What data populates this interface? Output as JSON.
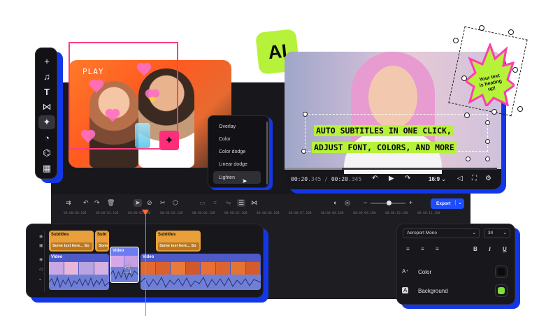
{
  "accent": "#1437e6",
  "lime": "#b6f23a",
  "toolbar": {
    "tools": [
      {
        "icon": "plus-icon",
        "glyph": "+"
      },
      {
        "icon": "music-add-icon",
        "glyph": "♫"
      },
      {
        "icon": "text-icon",
        "glyph": "T"
      },
      {
        "icon": "transition-icon",
        "glyph": "⋈"
      },
      {
        "icon": "effects-icon",
        "glyph": "✦"
      },
      {
        "icon": "filter-icon",
        "glyph": "◔"
      },
      {
        "icon": "sticker-icon",
        "glyph": "⌬"
      },
      {
        "icon": "templates-icon",
        "glyph": "▦"
      }
    ]
  },
  "left_preview": {
    "label": "PLAY"
  },
  "blend_menu": {
    "items": [
      "Overlay",
      "Color",
      "Color dodge",
      "Linear dodge",
      "Lighten"
    ],
    "hovered": "Lighten"
  },
  "ai_badge": "AI",
  "right_preview": {
    "subtitle_line1": "AUTO SUBTITLES IN ONE CLICK,",
    "subtitle_line2": "ADJUST FONT, COLORS, AND MORE",
    "time_current_bold": "00:20",
    "time_current_rest": ".345",
    "time_separator": " / ",
    "time_total_bold": "00:20",
    "time_total_rest": ".345",
    "aspect": "16:9",
    "progress": 0.27
  },
  "sticker": {
    "text": "Your text is heating up!"
  },
  "timeline": {
    "export_label": "Export",
    "ruler_ticks": [
      "00:00:00.100",
      "00:00:01.100",
      "00:00:02.100",
      "00:00:03.100",
      "00:00:04.100",
      "00:00:05.100",
      "00:00:06.100",
      "00:00:07.100",
      "00:00:08.100",
      "00:00:09.100",
      "00:00:10.100",
      "00:00:11.100",
      "00:00:12.100"
    ],
    "subtitle_clips": [
      {
        "title": "Subtitles",
        "text": "Some text here... So"
      },
      {
        "title": "Subt",
        "text": "Some"
      },
      {
        "title": "Subtitles",
        "text": "Some text here... So"
      }
    ],
    "video_clips": [
      {
        "title": "Video"
      },
      {
        "title": "Video"
      },
      {
        "title": "Video"
      }
    ]
  },
  "text_panel": {
    "font": "Aeroport Mono",
    "size": "34",
    "format_buttons": [
      "≡",
      "≡",
      "≡",
      "B",
      "I",
      "U"
    ],
    "color_label": "Color",
    "color_value": "#0a0a0a",
    "background_label": "Background",
    "background_value": "#7ee03a"
  }
}
